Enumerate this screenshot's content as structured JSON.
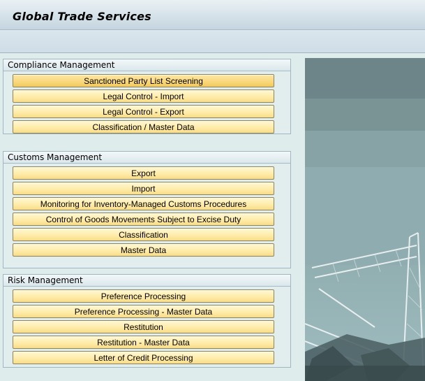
{
  "window": {
    "title": "Global Trade Services"
  },
  "groups": [
    {
      "title": "Compliance Management",
      "buttons": [
        "Sanctioned Party List Screening",
        "Legal Control - Import",
        "Legal Control - Export",
        "Classification / Master Data"
      ]
    },
    {
      "title": "Customs Management",
      "buttons": [
        "Export",
        "Import",
        "Monitoring for Inventory-Managed Customs Procedures",
        "Control of Goods Movements Subject to Excise Duty",
        "Classification",
        "Master Data"
      ]
    },
    {
      "title": "Risk Management",
      "buttons": [
        "Preference Processing",
        "Preference Processing - Master Data",
        "Restitution",
        "Restitution - Master Data",
        "Letter of Credit Processing"
      ]
    }
  ]
}
